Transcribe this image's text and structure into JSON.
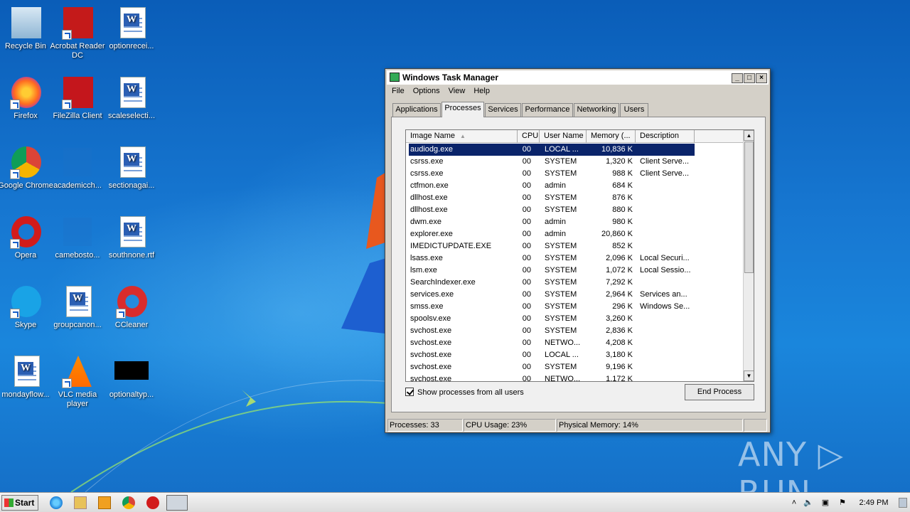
{
  "desktop": {
    "icons": [
      {
        "label": "Recycle Bin",
        "icon": "recycle-bin-icon"
      },
      {
        "label": "Acrobat Reader DC",
        "icon": "acrobat-icon"
      },
      {
        "label": "optionrecei...",
        "icon": "word-doc-icon"
      },
      {
        "label": "Firefox",
        "icon": "firefox-icon"
      },
      {
        "label": "FileZilla Client",
        "icon": "filezilla-icon"
      },
      {
        "label": "scaleselecti...",
        "icon": "word-doc-icon"
      },
      {
        "label": "Google Chrome",
        "icon": "chrome-icon"
      },
      {
        "label": "academicch...",
        "icon": "blank-file-icon"
      },
      {
        "label": "sectionagai...",
        "icon": "word-doc-icon"
      },
      {
        "label": "Opera",
        "icon": "opera-icon"
      },
      {
        "label": "camebosto...",
        "icon": "blank-file-icon"
      },
      {
        "label": "southnone.rtf",
        "icon": "word-doc-icon"
      },
      {
        "label": "Skype",
        "icon": "skype-icon"
      },
      {
        "label": "groupcanon...",
        "icon": "word-doc-icon"
      },
      {
        "label": "CCleaner",
        "icon": "ccleaner-icon"
      },
      {
        "label": "mondayflow...",
        "icon": "word-doc-icon"
      },
      {
        "label": "VLC media player",
        "icon": "vlc-icon"
      },
      {
        "label": "optionaltyp...",
        "icon": "black-thumbnail-icon"
      }
    ]
  },
  "taskmanager": {
    "title": "Windows Task Manager",
    "menu": [
      "File",
      "Options",
      "View",
      "Help"
    ],
    "tabs": [
      "Applications",
      "Processes",
      "Services",
      "Performance",
      "Networking",
      "Users"
    ],
    "active_tab": "Processes",
    "columns": [
      "Image Name",
      "CPU",
      "User Name",
      "Memory (...",
      "Description"
    ],
    "sort_indicator": "▲",
    "processes": [
      {
        "name": "audiodg.exe",
        "cpu": "00",
        "user": "LOCAL ...",
        "mem": "10,836 K",
        "desc": ""
      },
      {
        "name": "csrss.exe",
        "cpu": "00",
        "user": "SYSTEM",
        "mem": "1,320 K",
        "desc": "Client Serve..."
      },
      {
        "name": "csrss.exe",
        "cpu": "00",
        "user": "SYSTEM",
        "mem": "988 K",
        "desc": "Client Serve..."
      },
      {
        "name": "ctfmon.exe",
        "cpu": "00",
        "user": "admin",
        "mem": "684 K",
        "desc": ""
      },
      {
        "name": "dllhost.exe",
        "cpu": "00",
        "user": "SYSTEM",
        "mem": "876 K",
        "desc": ""
      },
      {
        "name": "dllhost.exe",
        "cpu": "00",
        "user": "SYSTEM",
        "mem": "880 K",
        "desc": ""
      },
      {
        "name": "dwm.exe",
        "cpu": "00",
        "user": "admin",
        "mem": "980 K",
        "desc": ""
      },
      {
        "name": "explorer.exe",
        "cpu": "00",
        "user": "admin",
        "mem": "20,860 K",
        "desc": ""
      },
      {
        "name": "IMEDICTUPDATE.EXE",
        "cpu": "00",
        "user": "SYSTEM",
        "mem": "852 K",
        "desc": ""
      },
      {
        "name": "lsass.exe",
        "cpu": "00",
        "user": "SYSTEM",
        "mem": "2,096 K",
        "desc": "Local Securi..."
      },
      {
        "name": "lsm.exe",
        "cpu": "00",
        "user": "SYSTEM",
        "mem": "1,072 K",
        "desc": "Local Sessio..."
      },
      {
        "name": "SearchIndexer.exe",
        "cpu": "00",
        "user": "SYSTEM",
        "mem": "7,292 K",
        "desc": ""
      },
      {
        "name": "services.exe",
        "cpu": "00",
        "user": "SYSTEM",
        "mem": "2,964 K",
        "desc": "Services an..."
      },
      {
        "name": "smss.exe",
        "cpu": "00",
        "user": "SYSTEM",
        "mem": "296 K",
        "desc": "Windows Se..."
      },
      {
        "name": "spoolsv.exe",
        "cpu": "00",
        "user": "SYSTEM",
        "mem": "3,260 K",
        "desc": ""
      },
      {
        "name": "svchost.exe",
        "cpu": "00",
        "user": "SYSTEM",
        "mem": "2,836 K",
        "desc": ""
      },
      {
        "name": "svchost.exe",
        "cpu": "00",
        "user": "NETWO...",
        "mem": "4,208 K",
        "desc": ""
      },
      {
        "name": "svchost.exe",
        "cpu": "00",
        "user": "LOCAL ...",
        "mem": "3,180 K",
        "desc": ""
      },
      {
        "name": "svchost.exe",
        "cpu": "00",
        "user": "SYSTEM",
        "mem": "9,196 K",
        "desc": ""
      },
      {
        "name": "svchost.exe",
        "cpu": "00",
        "user": "NETWO...",
        "mem": "1,172 K",
        "desc": ""
      }
    ],
    "show_all_label": "Show processes from all users",
    "end_process_label": "End Process",
    "status": {
      "processes": "Processes: 33",
      "cpu": "CPU Usage: 23%",
      "memory": "Physical Memory: 14%"
    }
  },
  "taskbar": {
    "start_label": "Start",
    "clock": "2:49 PM"
  },
  "watermark": "ANY ▷ RUN"
}
